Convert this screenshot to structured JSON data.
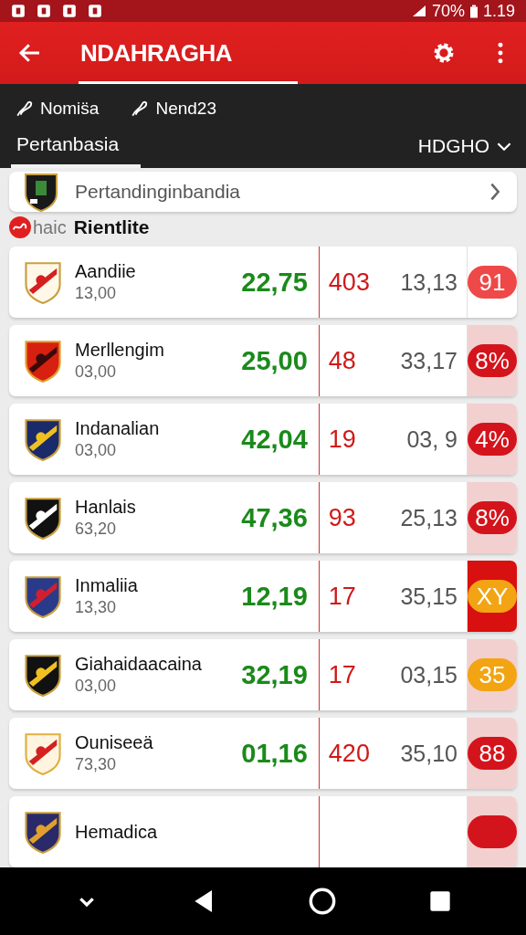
{
  "status_bar": {
    "battery": "70%",
    "time": "1.19"
  },
  "app_bar": {
    "title": "NDAHRAGHA"
  },
  "links": [
    {
      "label": "Nomis̈a"
    },
    {
      "label": "Nend23"
    }
  ],
  "tabs": [
    {
      "label": "Pertanbasia",
      "selected": true
    }
  ],
  "dropdown": {
    "label": "HDGHO"
  },
  "league_card": {
    "label": "Pertandinginbandia"
  },
  "section": {
    "prefix": "haic",
    "title": "Rientlite"
  },
  "rows": [
    {
      "name": "Aandiie",
      "sub": "13,00",
      "odds": "22,75",
      "count": "403",
      "value": "13,13",
      "badge": "91",
      "color": "#ef4848",
      "kind": "plain"
    },
    {
      "name": "Merllengim",
      "sub": "03,00",
      "odds": "25,00",
      "count": "48",
      "value": "33,17",
      "badge": "8%",
      "color": "#d4141c",
      "kind": "tinted"
    },
    {
      "name": "Indanalian",
      "sub": "03,00",
      "odds": "42,04",
      "count": "19",
      "value": "03, 9",
      "badge": "4%",
      "color": "#d4141c",
      "kind": "tinted"
    },
    {
      "name": "Hanlais",
      "sub": "63,20",
      "odds": "47,36",
      "count": "93",
      "value": "25,13",
      "badge": "8%",
      "color": "#d4141c",
      "kind": "tinted"
    },
    {
      "name": "Inmaliia",
      "sub": "13,30",
      "odds": "12,19",
      "count": "17",
      "value": "35,15",
      "badge": "XY",
      "color": "#f2a413",
      "kind": "strong"
    },
    {
      "name": "Giahaidaacaina",
      "sub": "03,00",
      "odds": "32,19",
      "count": "17",
      "value": "03,15",
      "badge": "35",
      "color": "#f2a413",
      "kind": "tinted"
    },
    {
      "name": "Ouniseeä",
      "sub": "73,30",
      "odds": "01,16",
      "count": "420",
      "value": "35,10",
      "badge": "88",
      "color": "#d4141c",
      "kind": "tinted"
    },
    {
      "name": "Hemadica",
      "color": "#d4141c",
      "kind": "tinted"
    }
  ]
}
